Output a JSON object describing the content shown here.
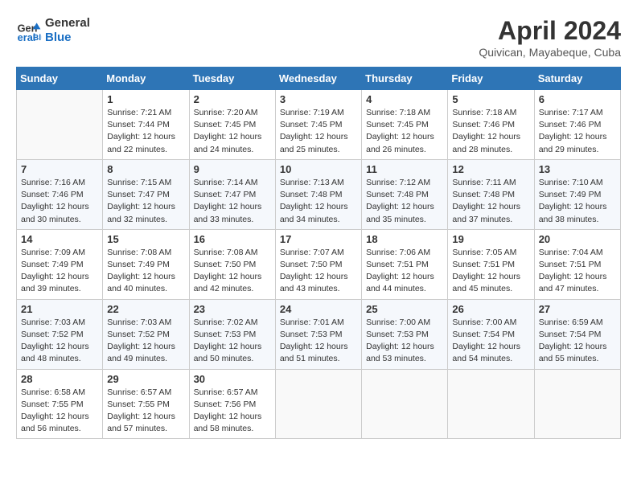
{
  "header": {
    "logo_line1": "General",
    "logo_line2": "Blue",
    "month": "April 2024",
    "location": "Quivican, Mayabeque, Cuba"
  },
  "columns": [
    "Sunday",
    "Monday",
    "Tuesday",
    "Wednesday",
    "Thursday",
    "Friday",
    "Saturday"
  ],
  "weeks": [
    [
      {
        "day": "",
        "info": ""
      },
      {
        "day": "1",
        "info": "Sunrise: 7:21 AM\nSunset: 7:44 PM\nDaylight: 12 hours\nand 22 minutes."
      },
      {
        "day": "2",
        "info": "Sunrise: 7:20 AM\nSunset: 7:45 PM\nDaylight: 12 hours\nand 24 minutes."
      },
      {
        "day": "3",
        "info": "Sunrise: 7:19 AM\nSunset: 7:45 PM\nDaylight: 12 hours\nand 25 minutes."
      },
      {
        "day": "4",
        "info": "Sunrise: 7:18 AM\nSunset: 7:45 PM\nDaylight: 12 hours\nand 26 minutes."
      },
      {
        "day": "5",
        "info": "Sunrise: 7:18 AM\nSunset: 7:46 PM\nDaylight: 12 hours\nand 28 minutes."
      },
      {
        "day": "6",
        "info": "Sunrise: 7:17 AM\nSunset: 7:46 PM\nDaylight: 12 hours\nand 29 minutes."
      }
    ],
    [
      {
        "day": "7",
        "info": "Sunrise: 7:16 AM\nSunset: 7:46 PM\nDaylight: 12 hours\nand 30 minutes."
      },
      {
        "day": "8",
        "info": "Sunrise: 7:15 AM\nSunset: 7:47 PM\nDaylight: 12 hours\nand 32 minutes."
      },
      {
        "day": "9",
        "info": "Sunrise: 7:14 AM\nSunset: 7:47 PM\nDaylight: 12 hours\nand 33 minutes."
      },
      {
        "day": "10",
        "info": "Sunrise: 7:13 AM\nSunset: 7:48 PM\nDaylight: 12 hours\nand 34 minutes."
      },
      {
        "day": "11",
        "info": "Sunrise: 7:12 AM\nSunset: 7:48 PM\nDaylight: 12 hours\nand 35 minutes."
      },
      {
        "day": "12",
        "info": "Sunrise: 7:11 AM\nSunset: 7:48 PM\nDaylight: 12 hours\nand 37 minutes."
      },
      {
        "day": "13",
        "info": "Sunrise: 7:10 AM\nSunset: 7:49 PM\nDaylight: 12 hours\nand 38 minutes."
      }
    ],
    [
      {
        "day": "14",
        "info": "Sunrise: 7:09 AM\nSunset: 7:49 PM\nDaylight: 12 hours\nand 39 minutes."
      },
      {
        "day": "15",
        "info": "Sunrise: 7:08 AM\nSunset: 7:49 PM\nDaylight: 12 hours\nand 40 minutes."
      },
      {
        "day": "16",
        "info": "Sunrise: 7:08 AM\nSunset: 7:50 PM\nDaylight: 12 hours\nand 42 minutes."
      },
      {
        "day": "17",
        "info": "Sunrise: 7:07 AM\nSunset: 7:50 PM\nDaylight: 12 hours\nand 43 minutes."
      },
      {
        "day": "18",
        "info": "Sunrise: 7:06 AM\nSunset: 7:51 PM\nDaylight: 12 hours\nand 44 minutes."
      },
      {
        "day": "19",
        "info": "Sunrise: 7:05 AM\nSunset: 7:51 PM\nDaylight: 12 hours\nand 45 minutes."
      },
      {
        "day": "20",
        "info": "Sunrise: 7:04 AM\nSunset: 7:51 PM\nDaylight: 12 hours\nand 47 minutes."
      }
    ],
    [
      {
        "day": "21",
        "info": "Sunrise: 7:03 AM\nSunset: 7:52 PM\nDaylight: 12 hours\nand 48 minutes."
      },
      {
        "day": "22",
        "info": "Sunrise: 7:03 AM\nSunset: 7:52 PM\nDaylight: 12 hours\nand 49 minutes."
      },
      {
        "day": "23",
        "info": "Sunrise: 7:02 AM\nSunset: 7:53 PM\nDaylight: 12 hours\nand 50 minutes."
      },
      {
        "day": "24",
        "info": "Sunrise: 7:01 AM\nSunset: 7:53 PM\nDaylight: 12 hours\nand 51 minutes."
      },
      {
        "day": "25",
        "info": "Sunrise: 7:00 AM\nSunset: 7:53 PM\nDaylight: 12 hours\nand 53 minutes."
      },
      {
        "day": "26",
        "info": "Sunrise: 7:00 AM\nSunset: 7:54 PM\nDaylight: 12 hours\nand 54 minutes."
      },
      {
        "day": "27",
        "info": "Sunrise: 6:59 AM\nSunset: 7:54 PM\nDaylight: 12 hours\nand 55 minutes."
      }
    ],
    [
      {
        "day": "28",
        "info": "Sunrise: 6:58 AM\nSunset: 7:55 PM\nDaylight: 12 hours\nand 56 minutes."
      },
      {
        "day": "29",
        "info": "Sunrise: 6:57 AM\nSunset: 7:55 PM\nDaylight: 12 hours\nand 57 minutes."
      },
      {
        "day": "30",
        "info": "Sunrise: 6:57 AM\nSunset: 7:56 PM\nDaylight: 12 hours\nand 58 minutes."
      },
      {
        "day": "",
        "info": ""
      },
      {
        "day": "",
        "info": ""
      },
      {
        "day": "",
        "info": ""
      },
      {
        "day": "",
        "info": ""
      }
    ]
  ]
}
